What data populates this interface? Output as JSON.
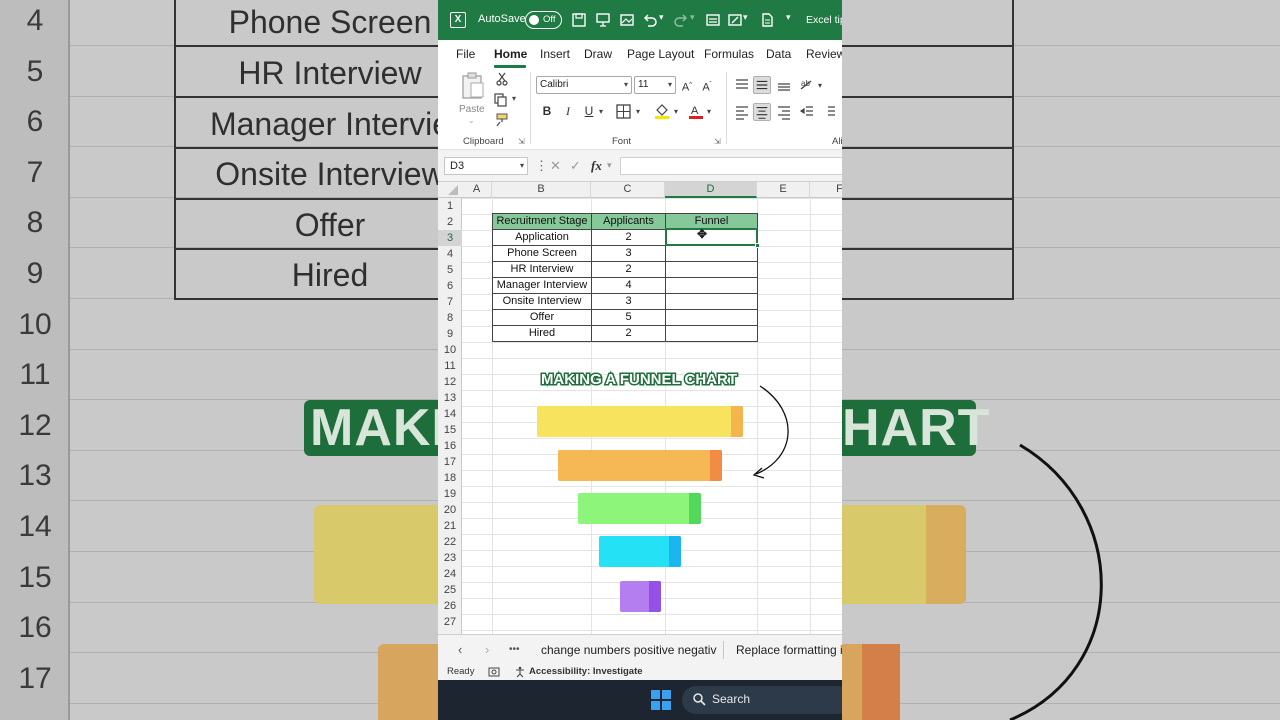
{
  "window": {
    "autosave_label": "AutoSave",
    "autosave_state": "Off",
    "file_title": "Excel tip"
  },
  "menu": {
    "tabs": [
      "File",
      "Home",
      "Insert",
      "Draw",
      "Page Layout",
      "Formulas",
      "Data",
      "Review"
    ],
    "active": "Home"
  },
  "ribbon": {
    "paste_label": "Paste",
    "clipboard_label": "Clipboard",
    "font_label": "Font",
    "alignment_label": "Ali",
    "font_name": "Calibri",
    "font_size": "11",
    "bold": "B",
    "italic": "I",
    "underline": "U"
  },
  "formula_bar": {
    "name_box": "D3",
    "fx": "fx",
    "value": ""
  },
  "grid": {
    "columns": [
      "A",
      "B",
      "C",
      "D",
      "E",
      "F"
    ],
    "selected_column": "D",
    "rows": [
      "1",
      "2",
      "3",
      "4",
      "5",
      "6",
      "7",
      "8",
      "9",
      "10",
      "11",
      "12",
      "13",
      "14",
      "15",
      "16",
      "17",
      "18",
      "19",
      "20",
      "21",
      "22",
      "23",
      "24",
      "25",
      "26",
      "27"
    ],
    "selected_row": "3"
  },
  "table": {
    "headers": [
      "Recruitment Stage",
      "Applicants",
      "Funnel percentage"
    ],
    "rows": [
      {
        "stage": "Application",
        "applicants": "2",
        "percent": ""
      },
      {
        "stage": "Phone Screen",
        "applicants": "3",
        "percent": ""
      },
      {
        "stage": "HR Interview",
        "applicants": "2",
        "percent": ""
      },
      {
        "stage": "Manager Interview",
        "applicants": "4",
        "percent": ""
      },
      {
        "stage": "Onsite Interview",
        "applicants": "3",
        "percent": ""
      },
      {
        "stage": "Offer",
        "applicants": "5",
        "percent": ""
      },
      {
        "stage": "Hired",
        "applicants": "2",
        "percent": ""
      }
    ]
  },
  "overlay": {
    "title": "MAKING A FUNNEL CHART",
    "bar_colors": [
      {
        "main": "#f7e35e",
        "end": "#f5b54d"
      },
      {
        "main": "#f6b755",
        "end": "#f28b43"
      },
      {
        "main": "#8cf57a",
        "end": "#53d85c"
      },
      {
        "main": "#24e1f6",
        "end": "#1bb6ef"
      },
      {
        "main": "#b47df0",
        "end": "#9550e6"
      }
    ]
  },
  "sheet_tabs": {
    "more": "•••",
    "tabs": [
      "change numbers positive negativ",
      "Replace formatting i"
    ]
  },
  "status": {
    "ready": "Ready",
    "accessibility": "Accessibility: Investigate"
  },
  "taskbar": {
    "search_label": "Search"
  },
  "backdrop": {
    "row_numbers": [
      "4",
      "5",
      "6",
      "7",
      "8",
      "9",
      "10",
      "11",
      "12",
      "13",
      "14",
      "15",
      "16",
      "17"
    ],
    "cells": [
      "Phone Screen",
      "HR Interview",
      "Manager Intervie",
      "Onsite Interview",
      "Offer",
      "Hired"
    ],
    "title": "MAKI",
    "title_end": "HART"
  }
}
